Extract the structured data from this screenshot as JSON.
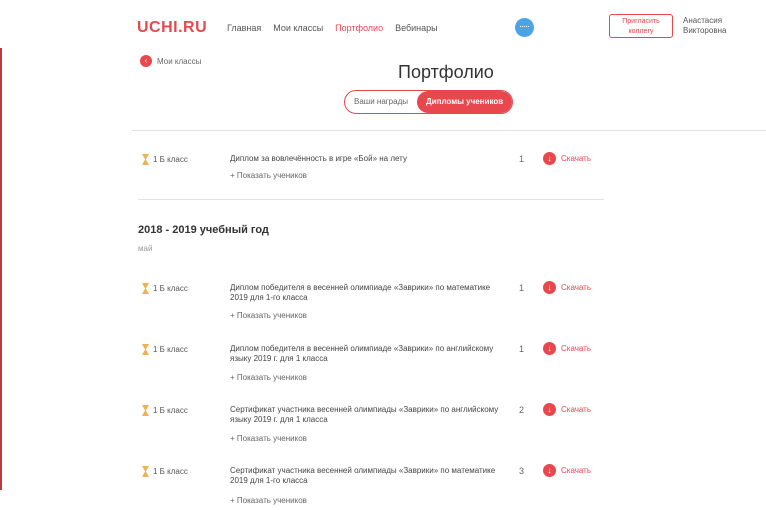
{
  "header": {
    "logo": "UCHI.RU",
    "nav": [
      "Главная",
      "Мои классы",
      "Портфолио",
      "Вебинары"
    ],
    "active_nav_index": 2,
    "invite_button": "Пригласить коллегу",
    "user_line1": "Анастасия",
    "user_line2": "Викторовна"
  },
  "back_link": "Мои классы",
  "page_title": "Портфолио",
  "segmented": {
    "options": [
      "Ваши награды",
      "Дипломы учеников"
    ],
    "active_index": 1
  },
  "top_entry": {
    "class": "1 Б класс",
    "description": "Диплом за вовлечённость в игре «Бой» на лету",
    "show_students": "+ Показать учеников",
    "count": "1",
    "download": "Скачать"
  },
  "year_section": {
    "title": "2018 - 2019 учебный год",
    "month": "май",
    "entries": [
      {
        "class": "1 Б класс",
        "description": "Диплом победителя в весенней олимпиаде «Заврики» по математике 2019 для 1-го класса",
        "show_students": "+ Показать учеников",
        "count": "1",
        "download": "Скачать"
      },
      {
        "class": "1 Б класс",
        "description": "Диплом победителя в весенней олимпиаде «Заврики» по английскому языку 2019 г. для 1 класса",
        "show_students": "+ Показать учеников",
        "count": "1",
        "download": "Скачать"
      },
      {
        "class": "1 Б класс",
        "description": "Сертификат участника весенней олимпиады «Заврики» по английскому языку 2019 г. для 1 класса",
        "show_students": "+ Показать учеников",
        "count": "2",
        "download": "Скачать"
      },
      {
        "class": "1 Б класс",
        "description": "Сертификат участника весенней олимпиады «Заврики» по математике 2019 для 1-го класса",
        "show_students": "+ Показать учеников",
        "count": "3",
        "download": "Скачать"
      }
    ]
  },
  "colors": {
    "accent": "#e8474e",
    "chat": "#4aa4e6",
    "hourglass": "#f0b24c"
  },
  "icons": {
    "back": "back-arrow-icon",
    "download": "download-icon",
    "class": "hourglass-icon",
    "chat": "chat-icon"
  }
}
